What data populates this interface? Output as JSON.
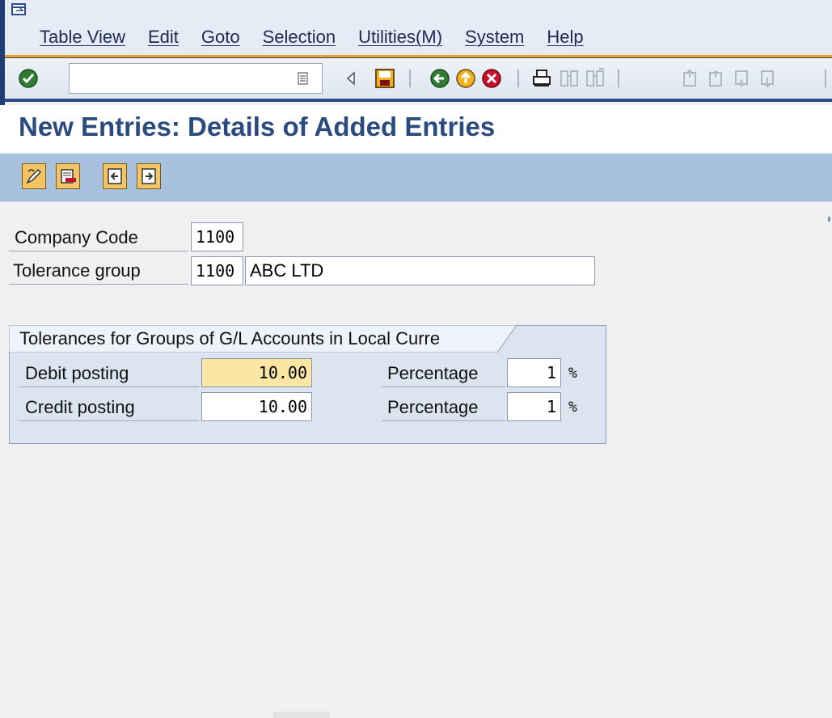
{
  "menubar": {
    "items": [
      {
        "label": "Table View"
      },
      {
        "label": "Edit"
      },
      {
        "label": "Goto"
      },
      {
        "label": "Selection"
      },
      {
        "label": "Utilities(M)"
      },
      {
        "label": "System"
      },
      {
        "label": "Help"
      }
    ]
  },
  "systoolbar": {
    "command_field_value": "",
    "icons": [
      "enter-icon",
      "command-dropdown-icon",
      "back-triangle-icon",
      "save-icon",
      "back-icon",
      "exit-icon",
      "cancel-icon",
      "print-icon",
      "find-icon",
      "find-next-icon",
      "first-page-icon",
      "previous-page-icon",
      "next-page-icon",
      "last-page-icon"
    ]
  },
  "page": {
    "title": "New Entries: Details of Added Entries"
  },
  "apptoolbar": {
    "icons": [
      "change-icon",
      "delete-icon",
      "previous-entry-icon",
      "next-entry-icon"
    ]
  },
  "form": {
    "company_code_label": "Company Code",
    "company_code_value": "1100",
    "tolerance_group_label": "Tolerance group",
    "tolerance_group_value": "1100",
    "tolerance_group_desc": "ABC LTD"
  },
  "group": {
    "title": "Tolerances for Groups of G/L Accounts in Local Curre",
    "rows": [
      {
        "label": "Debit posting",
        "amount": "10.00",
        "pct_label": "Percentage",
        "pct_value": "1",
        "pct_sign": "%"
      },
      {
        "label": "Credit posting",
        "amount": "10.00",
        "pct_label": "Percentage",
        "pct_value": "1",
        "pct_sign": "%"
      }
    ]
  },
  "colors": {
    "title": "#2b4b7e",
    "menubar": "#e6ecf5",
    "apptoolbar": "#a8c1df",
    "highlight_field": "#fbe6a3",
    "groupbox": "#dce5ef"
  }
}
